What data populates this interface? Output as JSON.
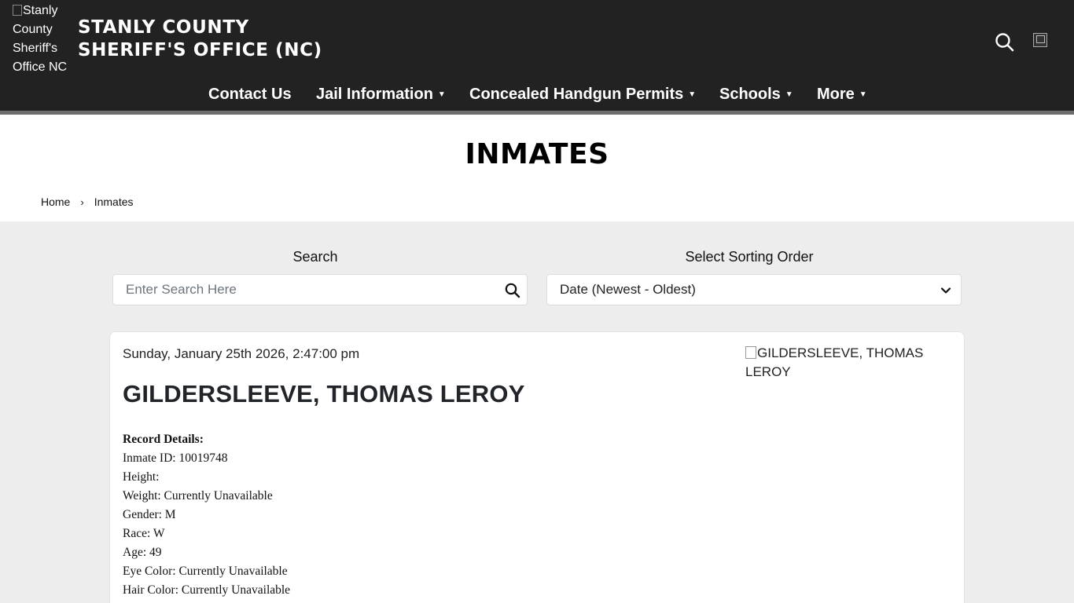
{
  "header": {
    "logo_alt": "Stanly County Sheriff's Office NC",
    "site_title_line1": "STANLY COUNTY",
    "site_title_line2": "SHERIFF'S OFFICE (NC)",
    "search_icon": "search-icon",
    "language_icon": "broken-image-icon"
  },
  "nav": {
    "items": [
      {
        "label": "Contact Us",
        "has_dropdown": false
      },
      {
        "label": "Jail Information",
        "has_dropdown": true
      },
      {
        "label": "Concealed Handgun Permits",
        "has_dropdown": true
      },
      {
        "label": "Schools",
        "has_dropdown": true
      },
      {
        "label": "More",
        "has_dropdown": true
      }
    ],
    "caret": "▼"
  },
  "page": {
    "title": "INMATES",
    "breadcrumb": {
      "home": "Home",
      "separator": "›",
      "current": "Inmates"
    }
  },
  "search": {
    "label": "Search",
    "placeholder": "Enter Search Here",
    "value": ""
  },
  "sort": {
    "label": "Select Sorting Order",
    "selected": "Date (Newest - Oldest)"
  },
  "inmate": {
    "date": "Sunday, January 25th 2026, 2:47:00 pm",
    "name": "GILDERSLEEVE, THOMAS LEROY",
    "photo_alt": "GILDERSLEEVE, THOMAS LEROY",
    "details_heading": "Record Details:",
    "details": [
      "Inmate ID: 10019748",
      "Height:",
      "Weight: Currently Unavailable",
      "Gender: M",
      "Race: W",
      "Age: 49",
      "Eye Color: Currently Unavailable",
      "Hair Color: Currently Unavailable"
    ]
  },
  "colors": {
    "header_bg": "#222222",
    "header_border": "#6d6d6d",
    "page_bg": "#ededed",
    "text_dark": "#212529"
  }
}
